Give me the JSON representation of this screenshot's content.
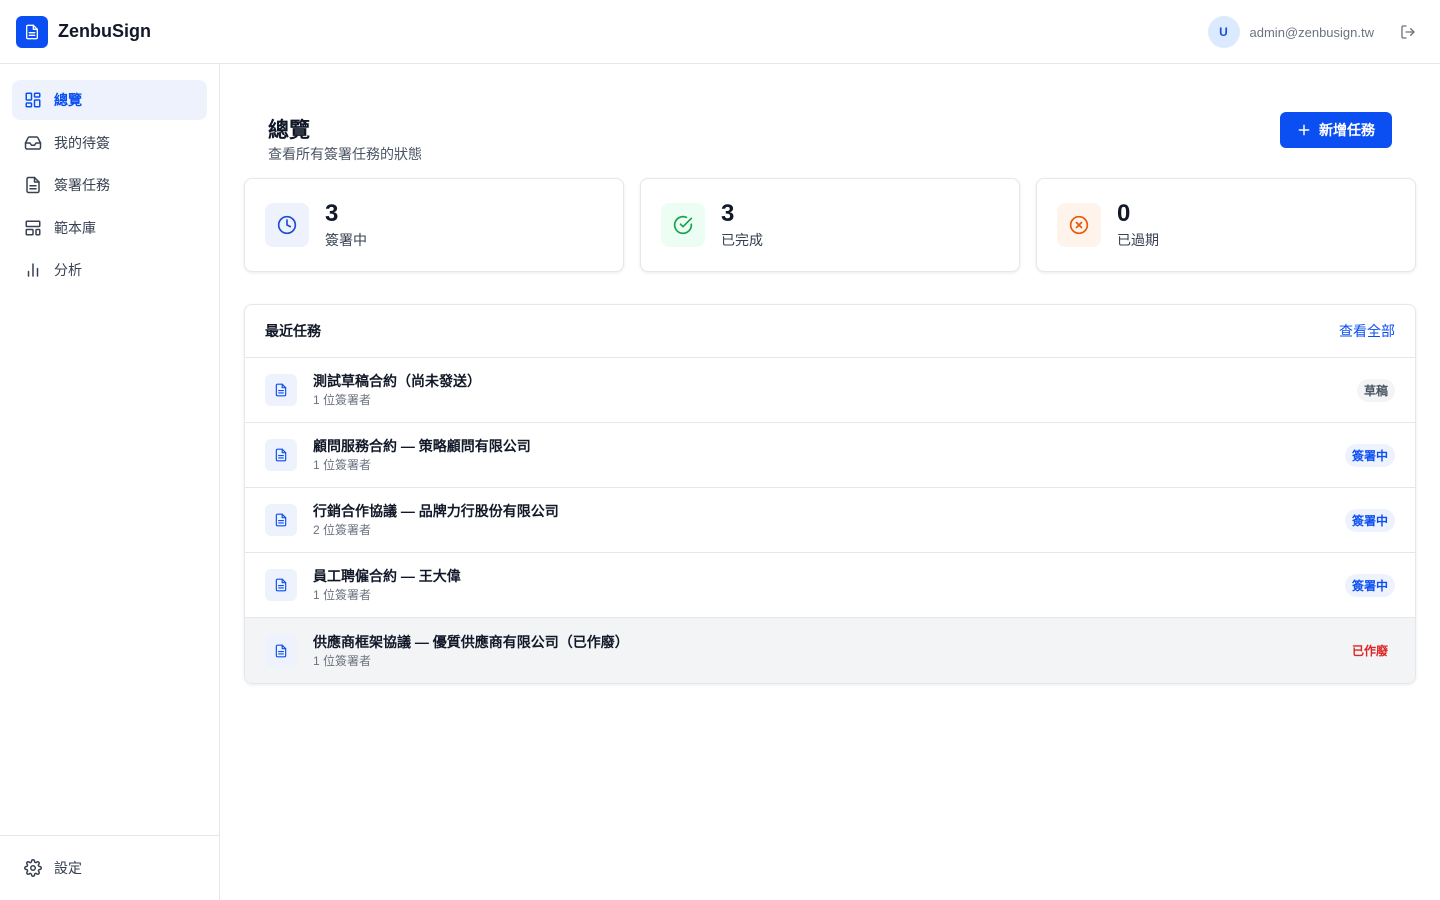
{
  "app": {
    "name": "ZenbuSign"
  },
  "user": {
    "initial": "U",
    "email": "admin@zenbusign.tw"
  },
  "sidebar": {
    "items": [
      {
        "label": "總覽",
        "active": true
      },
      {
        "label": "我的待簽"
      },
      {
        "label": "簽署任務"
      },
      {
        "label": "範本庫"
      },
      {
        "label": "分析"
      }
    ],
    "settings_label": "設定"
  },
  "page": {
    "title": "總覽",
    "subtitle": "查看所有簽署任務的狀態",
    "new_button_label": "新增任務"
  },
  "stats": [
    {
      "value": "3",
      "label": "簽署中",
      "color": "#1d4ed8"
    },
    {
      "value": "3",
      "label": "已完成",
      "color": "#16a34a"
    },
    {
      "value": "0",
      "label": "已過期",
      "color": "#ea580c"
    }
  ],
  "recent": {
    "title": "最近任務",
    "view_all": "查看全部",
    "tasks": [
      {
        "name": "測試草稿合約（尚未發送）",
        "meta": "1 位簽署者",
        "status": "草稿"
      },
      {
        "name": "顧問服務合約 — 策略顧問有限公司",
        "meta": "1 位簽署者",
        "status": "簽署中"
      },
      {
        "name": "行銷合作協議 — 品牌力行股份有限公司",
        "meta": "2 位簽署者",
        "status": "簽署中"
      },
      {
        "name": "員工聘僱合約 — 王大偉",
        "meta": "1 位簽署者",
        "status": "簽署中"
      },
      {
        "name": "供應商框架協議 — 優質供應商有限公司（已作廢）",
        "meta": "1 位簽署者",
        "status": "已作廢"
      }
    ]
  }
}
